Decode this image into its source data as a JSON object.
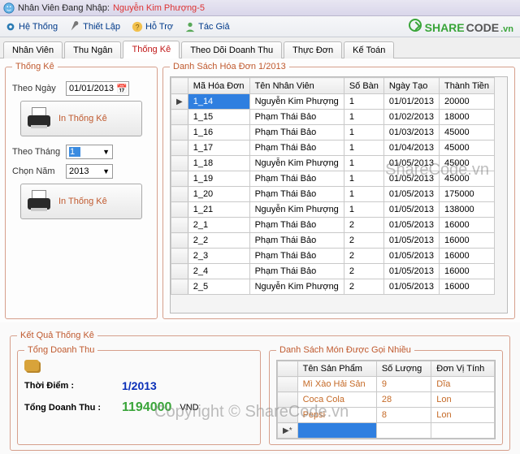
{
  "title": {
    "prefix": "Nhân Viên Đang Nhập: ",
    "login_name": "Nguyễn Kim Phượng-5"
  },
  "menu": {
    "he_thong": "Hệ Thống",
    "thiet_lap": "Thiết Lập",
    "ho_tro": "Hỗ Trợ",
    "tac_gia": "Tác Giả"
  },
  "brand": {
    "share": "SHARE",
    "code": "CODE",
    "dotvn": ".vn"
  },
  "tabs": {
    "nhan_vien": "Nhân Viên",
    "thu_ngan": "Thu Ngân",
    "thong_ke": "Thống Kê",
    "doanh_thu": "Theo Dõi Doanh Thu",
    "thuc_don": "Thực Đơn",
    "ke_toan": "Kế Toán"
  },
  "left": {
    "legend": "Thống Kê",
    "theo_ngay_label": "Theo Ngày",
    "theo_ngay_value": "01/01/2013",
    "print_label": "In Thống Kê",
    "theo_thang_label": "Theo Tháng",
    "theo_thang_value": "1",
    "chon_nam_label": "Chọn Năm",
    "chon_nam_value": "2013"
  },
  "invoice_list": {
    "legend": "Danh Sách Hóa Đơn 1/2013",
    "cols": {
      "id": "Mã Hóa Đơn",
      "staff": "Tên Nhân Viên",
      "table": "Số Bàn",
      "date": "Ngày Tạo",
      "total": "Thành Tiền"
    },
    "rows": [
      {
        "id": "1_14",
        "staff": "Nguyễn Kim Phượng",
        "table": "1",
        "date": "01/01/2013",
        "total": "20000"
      },
      {
        "id": "1_15",
        "staff": "Phạm Thái Bảo",
        "table": "1",
        "date": "01/02/2013",
        "total": "18000"
      },
      {
        "id": "1_16",
        "staff": "Phạm Thái Bảo",
        "table": "1",
        "date": "01/03/2013",
        "total": "45000"
      },
      {
        "id": "1_17",
        "staff": "Phạm Thái Bảo",
        "table": "1",
        "date": "01/04/2013",
        "total": "45000"
      },
      {
        "id": "1_18",
        "staff": "Nguyễn Kim Phượng",
        "table": "1",
        "date": "01/05/2013",
        "total": "45000"
      },
      {
        "id": "1_19",
        "staff": "Phạm Thái Bảo",
        "table": "1",
        "date": "01/05/2013",
        "total": "45000"
      },
      {
        "id": "1_20",
        "staff": "Phạm Thái Bảo",
        "table": "1",
        "date": "01/05/2013",
        "total": "175000"
      },
      {
        "id": "1_21",
        "staff": "Nguyễn Kim Phượng",
        "table": "1",
        "date": "01/05/2013",
        "total": "138000"
      },
      {
        "id": "2_1",
        "staff": "Phạm Thái Bảo",
        "table": "2",
        "date": "01/05/2013",
        "total": "16000"
      },
      {
        "id": "2_2",
        "staff": "Phạm Thái Bảo",
        "table": "2",
        "date": "01/05/2013",
        "total": "16000"
      },
      {
        "id": "2_3",
        "staff": "Phạm Thái Bảo",
        "table": "2",
        "date": "01/05/2013",
        "total": "16000"
      },
      {
        "id": "2_4",
        "staff": "Phạm Thái Bảo",
        "table": "2",
        "date": "01/05/2013",
        "total": "16000"
      },
      {
        "id": "2_5",
        "staff": "Nguyễn Kim Phượng",
        "table": "2",
        "date": "01/05/2013",
        "total": "16000"
      }
    ]
  },
  "results": {
    "legend": "Kết Quả Thống Kê",
    "totals_legend": "Tổng Doanh Thu",
    "thoi_diem_label": "Thời Điểm :",
    "thoi_diem_value": "1/2013",
    "tong_label": "Tổng Doanh Thu :",
    "tong_value": "1194000",
    "currency": "VND",
    "dishes_legend": "Danh Sách Món Được Gọi Nhiều",
    "dish_cols": {
      "name": "Tên Sản Phẩm",
      "qty": "Số Lượng",
      "unit": "Đơn Vị Tính"
    },
    "dishes": [
      {
        "name": "Mì Xào Hải Sản",
        "qty": "9",
        "unit": "Dĩa"
      },
      {
        "name": "Coca Cola",
        "qty": "28",
        "unit": "Lon"
      },
      {
        "name": "Pepsi",
        "qty": "8",
        "unit": "Lon"
      }
    ]
  },
  "watermark1": "ShareCode.vn",
  "watermark2": "Copyright © ShareCode.vn"
}
